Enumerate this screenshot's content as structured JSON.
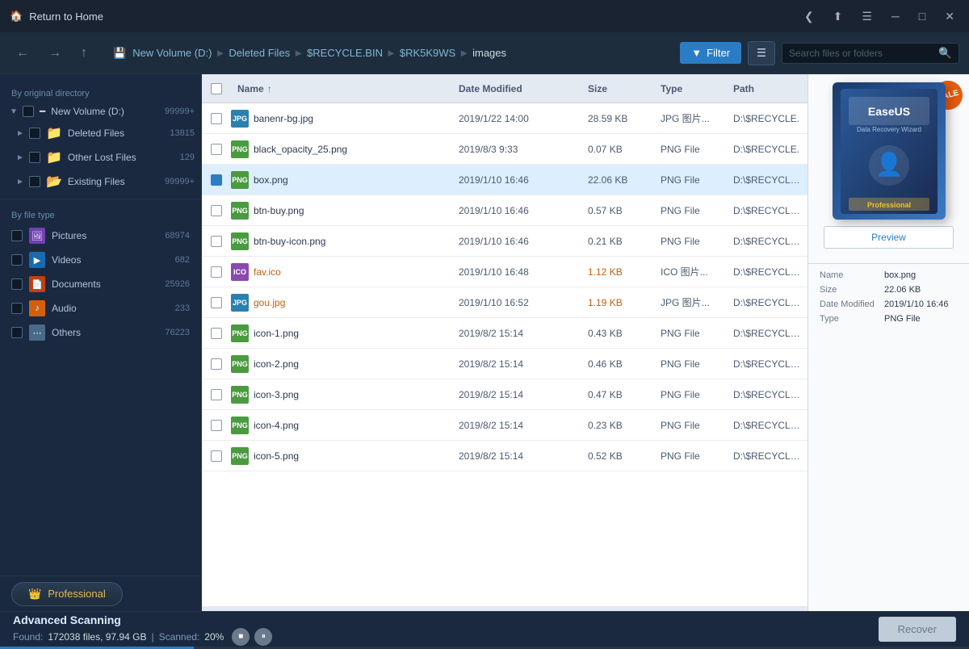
{
  "titlebar": {
    "title": "Return to Home",
    "home_icon": "🏠"
  },
  "toolbar": {
    "filter_label": "Filter",
    "search_placeholder": "Search files or folders",
    "breadcrumb": [
      "New Volume (D:)",
      "Deleted Files",
      "$RECYCLE.BIN",
      "$RK5K9WS",
      "images"
    ]
  },
  "sidebar": {
    "section_directory": "By original directory",
    "section_filetype": "By file type",
    "tree": {
      "root_label": "New Volume (D:)",
      "root_count": "99999+",
      "children": [
        {
          "label": "Deleted Files",
          "count": "13815",
          "color": "#e87020"
        },
        {
          "label": "Other Lost Files",
          "count": "129",
          "color": "#e87020"
        },
        {
          "label": "Existing Files",
          "count": "99999+",
          "color": "#f0c030"
        }
      ]
    },
    "filetypes": [
      {
        "label": "Pictures",
        "count": "68974",
        "color": "#7040b0"
      },
      {
        "label": "Videos",
        "count": "682",
        "color": "#1a6ab0"
      },
      {
        "label": "Documents",
        "count": "25926",
        "color": "#c04010"
      },
      {
        "label": "Audio",
        "count": "233",
        "color": "#d06010"
      },
      {
        "label": "Others",
        "count": "76223",
        "color": "#4a6a8a"
      }
    ]
  },
  "table": {
    "headers": [
      "Name",
      "Date Modified",
      "Size",
      "Type",
      "Path"
    ],
    "sort_col": "Name",
    "files": [
      {
        "name": "banenr-bg.jpg",
        "date": "2019/1/22 14:00",
        "size": "28.59 KB",
        "type": "JPG 图片...",
        "path": "D:\\$RECYCLE.",
        "ext": "jpg",
        "highlight": false
      },
      {
        "name": "black_opacity_25.png",
        "date": "2019/8/3 9:33",
        "size": "0.07 KB",
        "type": "PNG File",
        "path": "D:\\$RECYCLE.",
        "ext": "png",
        "highlight": false
      },
      {
        "name": "box.png",
        "date": "2019/1/10 16:46",
        "size": "22.06 KB",
        "type": "PNG File",
        "path": "D:\\$RECYCLE.B",
        "ext": "png",
        "highlight": true
      },
      {
        "name": "btn-buy.png",
        "date": "2019/1/10 16:46",
        "size": "0.57 KB",
        "type": "PNG File",
        "path": "D:\\$RECYCLE.B",
        "ext": "png",
        "highlight": false
      },
      {
        "name": "btn-buy-icon.png",
        "date": "2019/1/10 16:46",
        "size": "0.21 KB",
        "type": "PNG File",
        "path": "D:\\$RECYCLE.B",
        "ext": "png",
        "highlight": false
      },
      {
        "name": "fav.ico",
        "date": "2019/1/10 16:48",
        "size": "1.12 KB",
        "type": "ICO 图片...",
        "path": "D:\\$RECYCLE.B",
        "ext": "ico",
        "highlight": false,
        "orange": true
      },
      {
        "name": "gou.jpg",
        "date": "2019/1/10 16:52",
        "size": "1.19 KB",
        "type": "JPG 图片...",
        "path": "D:\\$RECYCLE.B",
        "ext": "jpg",
        "highlight": false,
        "orange": true
      },
      {
        "name": "icon-1.png",
        "date": "2019/8/2 15:14",
        "size": "0.43 KB",
        "type": "PNG File",
        "path": "D:\\$RECYCLE.B",
        "ext": "png",
        "highlight": false
      },
      {
        "name": "icon-2.png",
        "date": "2019/8/2 15:14",
        "size": "0.46 KB",
        "type": "PNG File",
        "path": "D:\\$RECYCLE.B",
        "ext": "png",
        "highlight": false
      },
      {
        "name": "icon-3.png",
        "date": "2019/8/2 15:14",
        "size": "0.47 KB",
        "type": "PNG File",
        "path": "D:\\$RECYCLE.B",
        "ext": "png",
        "highlight": false
      },
      {
        "name": "icon-4.png",
        "date": "2019/8/2 15:14",
        "size": "0.23 KB",
        "type": "PNG File",
        "path": "D:\\$RECYCLE.B",
        "ext": "png",
        "highlight": false
      },
      {
        "name": "icon-5.png",
        "date": "2019/8/2 15:14",
        "size": "0.52 KB",
        "type": "PNG File",
        "path": "D:\\$RECYCLE.B",
        "ext": "png",
        "highlight": false
      }
    ]
  },
  "right_panel": {
    "sale_badge": "SALE",
    "product_title": "EaseUS",
    "product_subtitle": "Data Recovery Wizard",
    "product_edition": "Professional",
    "preview_label": "Preview",
    "selected_file": {
      "name_label": "Name",
      "name_value": "box.png",
      "size_label": "Size",
      "size_value": "22.06 KB",
      "date_label": "Date Modified",
      "date_value": "2019/1/10 16:46",
      "type_label": "Type",
      "type_value": "PNG File"
    }
  },
  "bottom_bar": {
    "title": "Advanced Scanning",
    "found_label": "Found:",
    "found_value": "172038 files, 97.94 GB",
    "scanned_label": "Scanned:",
    "scanned_value": "20%",
    "recover_label": "Recover",
    "progress_pct": 20
  },
  "pro_button": {
    "label": "Professional",
    "icon": "👑"
  }
}
